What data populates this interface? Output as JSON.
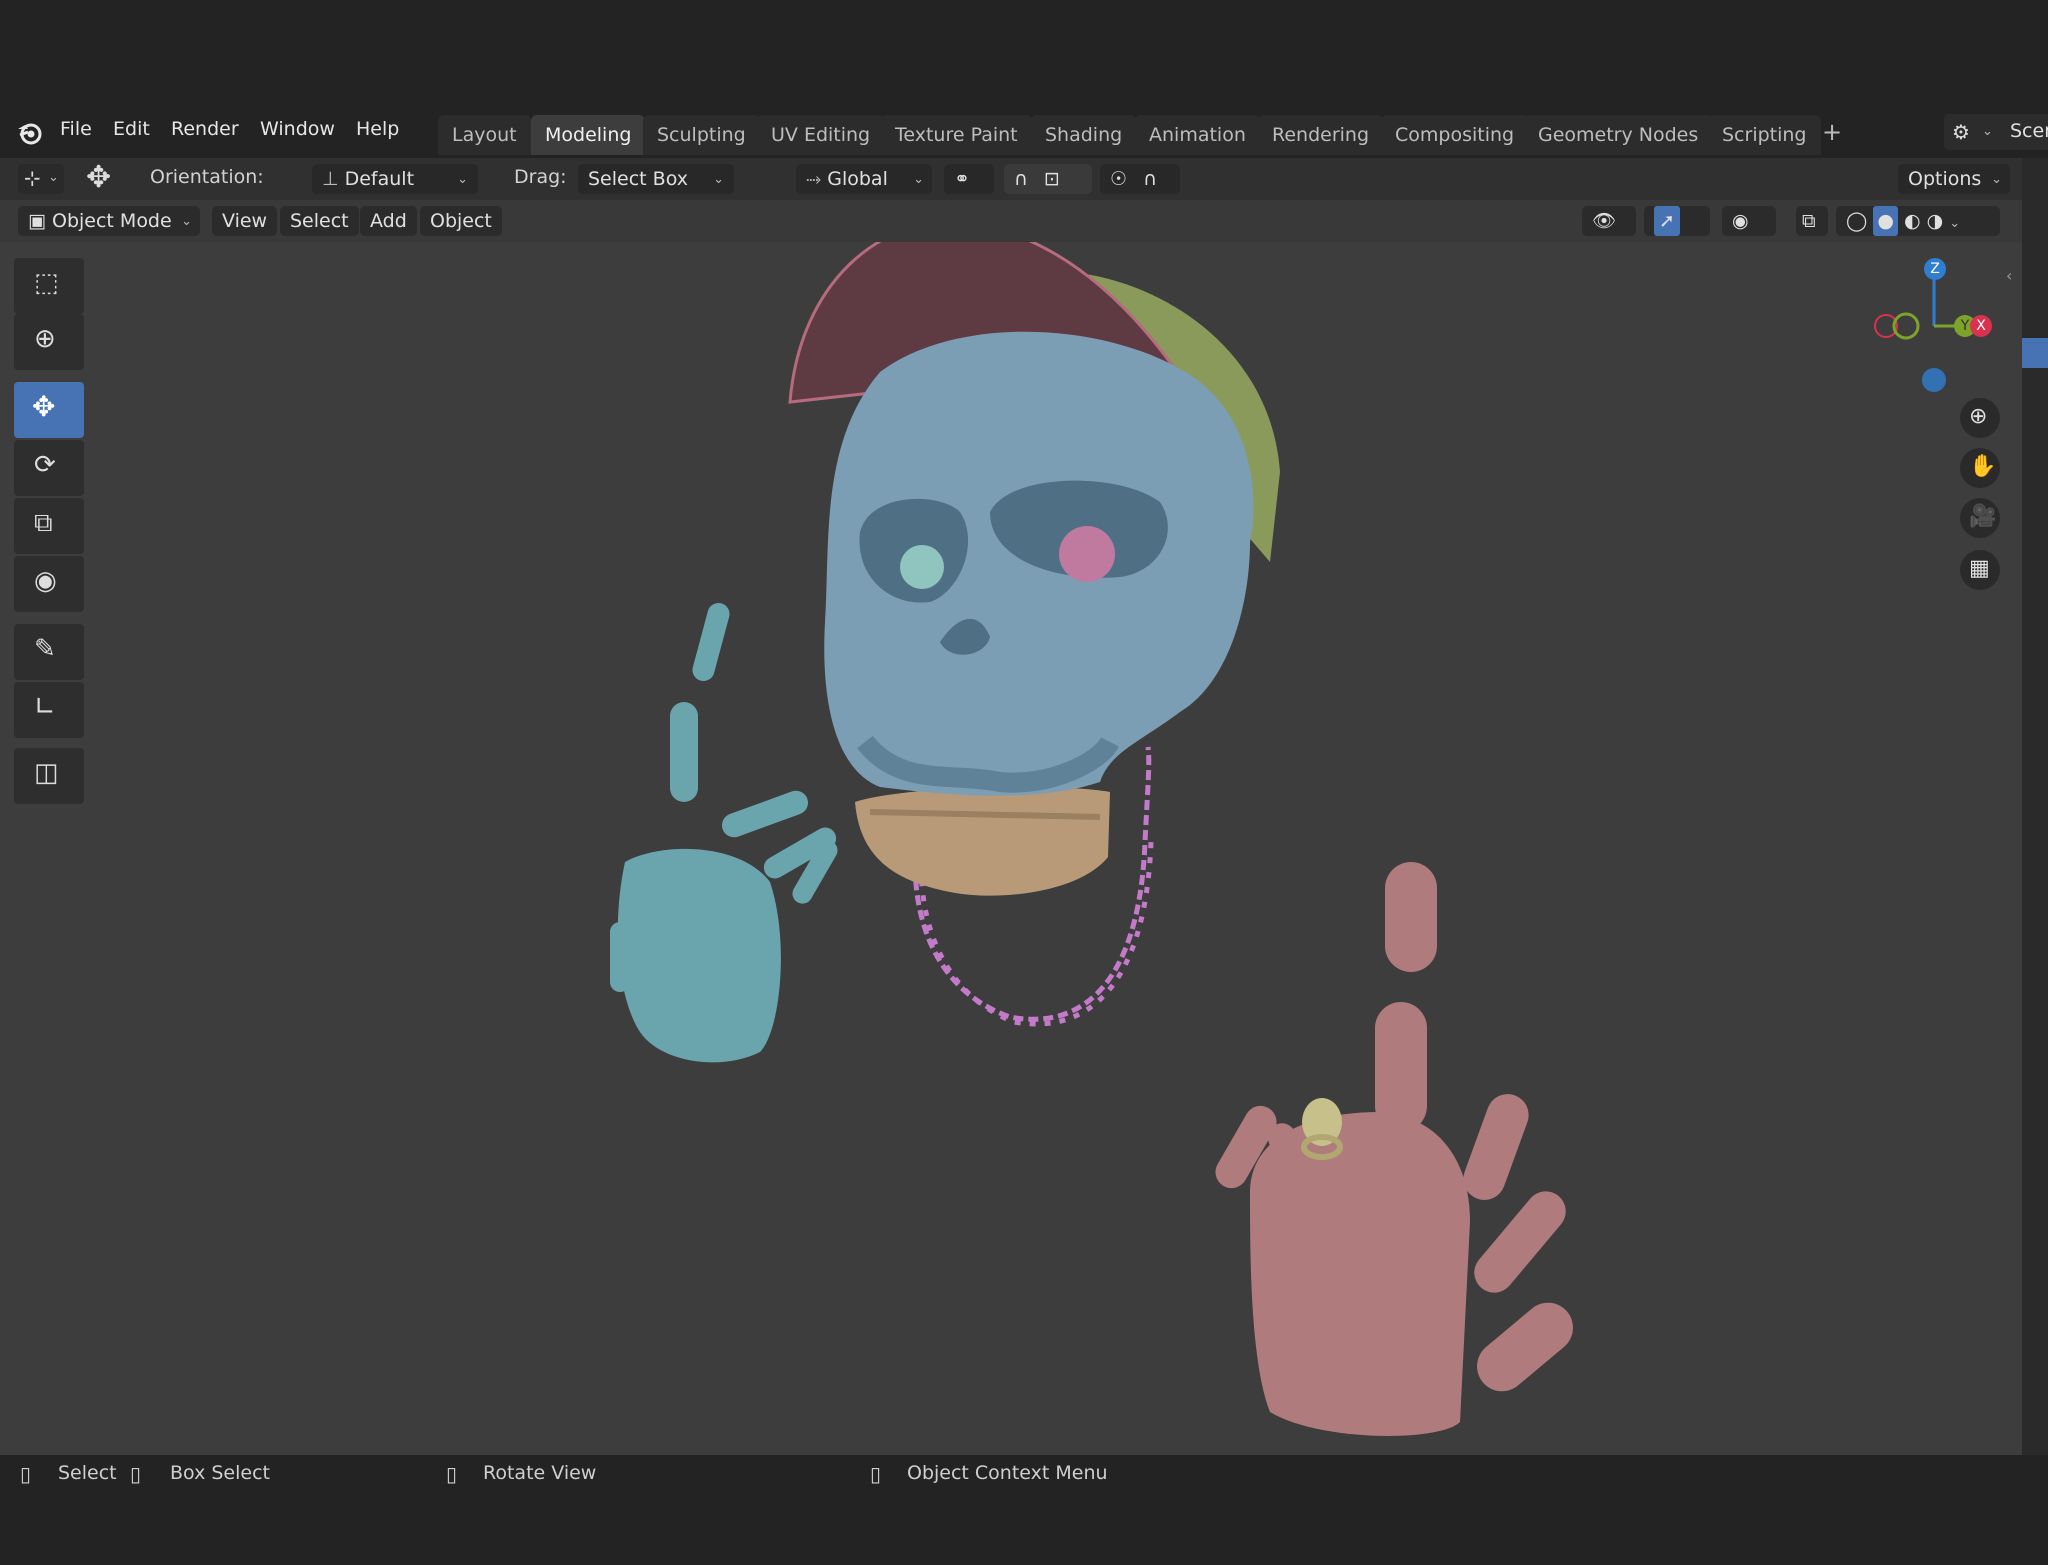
{
  "menu": [
    "File",
    "Edit",
    "Render",
    "Window",
    "Help"
  ],
  "workspaces": [
    "Layout",
    "Modeling",
    "Sculpting",
    "UV Editing",
    "Texture Paint",
    "Shading",
    "Animation",
    "Rendering",
    "Compositing",
    "Geometry Nodes",
    "Scripting"
  ],
  "active_workspace": "Modeling",
  "scene_label": "Scer",
  "tool_header": {
    "orientation_label": "Orientation:",
    "orientation_value": "Default",
    "drag_label": "Drag:",
    "drag_value": "Select Box",
    "transform_orientation": "Global",
    "options_label": "Options"
  },
  "viewport_header": {
    "mode": "Object Mode",
    "menus": [
      "View",
      "Select",
      "Add",
      "Object"
    ]
  },
  "gizmo": {
    "z": "Z",
    "x": "X",
    "y": "Y"
  },
  "status_bar": {
    "select": "Select",
    "box_select": "Box Select",
    "rotate_view": "Rotate View",
    "context_menu": "Object Context Menu"
  },
  "colors": {
    "skull": "#7b9eb5",
    "left_hand": "#6aa5ae",
    "right_hand": "#b07b7d",
    "cap_crown": "#8a9a5b",
    "cap_brim": "#5e3a42",
    "jaw": "#b89a78",
    "chain": "#c37bc9",
    "active_tool": "#4772b3"
  }
}
